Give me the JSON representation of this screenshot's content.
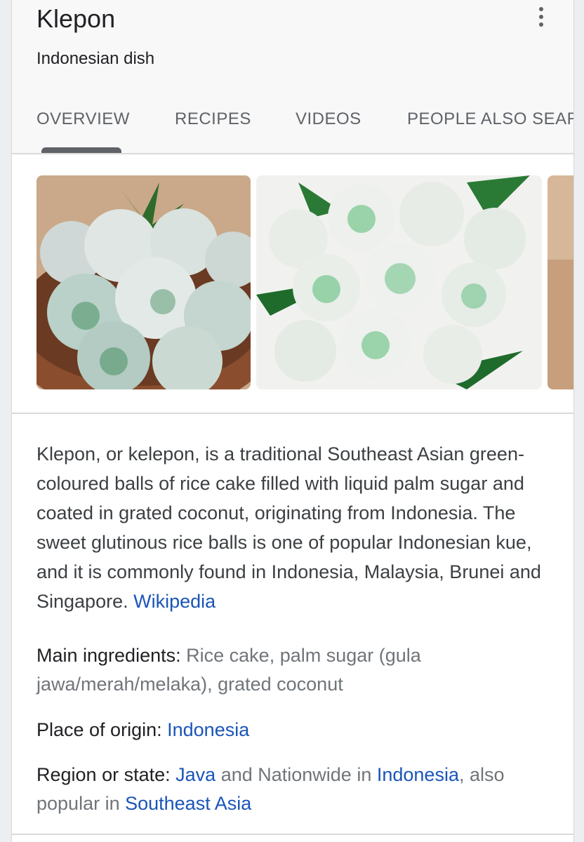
{
  "entity": {
    "title": "Klepon",
    "subtitle": "Indonesian dish"
  },
  "tabs": [
    {
      "label": "OVERVIEW",
      "selected": true
    },
    {
      "label": "RECIPES"
    },
    {
      "label": "VIDEOS"
    },
    {
      "label": "PEOPLE ALSO SEAR"
    }
  ],
  "images": [
    {
      "alt": "Klepon on plate"
    },
    {
      "alt": "Klepon on leaves"
    },
    {
      "alt": "Klepon partial"
    }
  ],
  "description": {
    "text": "Klepon, or kelepon, is a traditional Southeast Asian green-coloured balls of rice cake filled with liquid palm sugar and coated in grated coconut, originating from Indonesia. The sweet glutinous rice balls is one of popular Indonesian kue, and it is commonly found in Indonesia, Malaysia, Brunei and Singapore.",
    "source": "Wikipedia"
  },
  "facts": {
    "main_ingredients": {
      "label": "Main ingredients:",
      "value": "Rice cake, palm sugar (gula jawa/merah/melaka), grated coconut"
    },
    "place_of_origin": {
      "label": "Place of origin:",
      "value": "Indonesia"
    },
    "region": {
      "label": "Region or state:",
      "link1": "Java",
      "text1": "and Nationwide in",
      "link2": "Indonesia",
      "text2": ", also popular in",
      "link3": "Southeast Asia"
    }
  },
  "colors": {
    "link": "#1a55b8",
    "muted": "#70757a",
    "text": "#202124"
  },
  "icons": {
    "more": "more-vert-icon"
  }
}
